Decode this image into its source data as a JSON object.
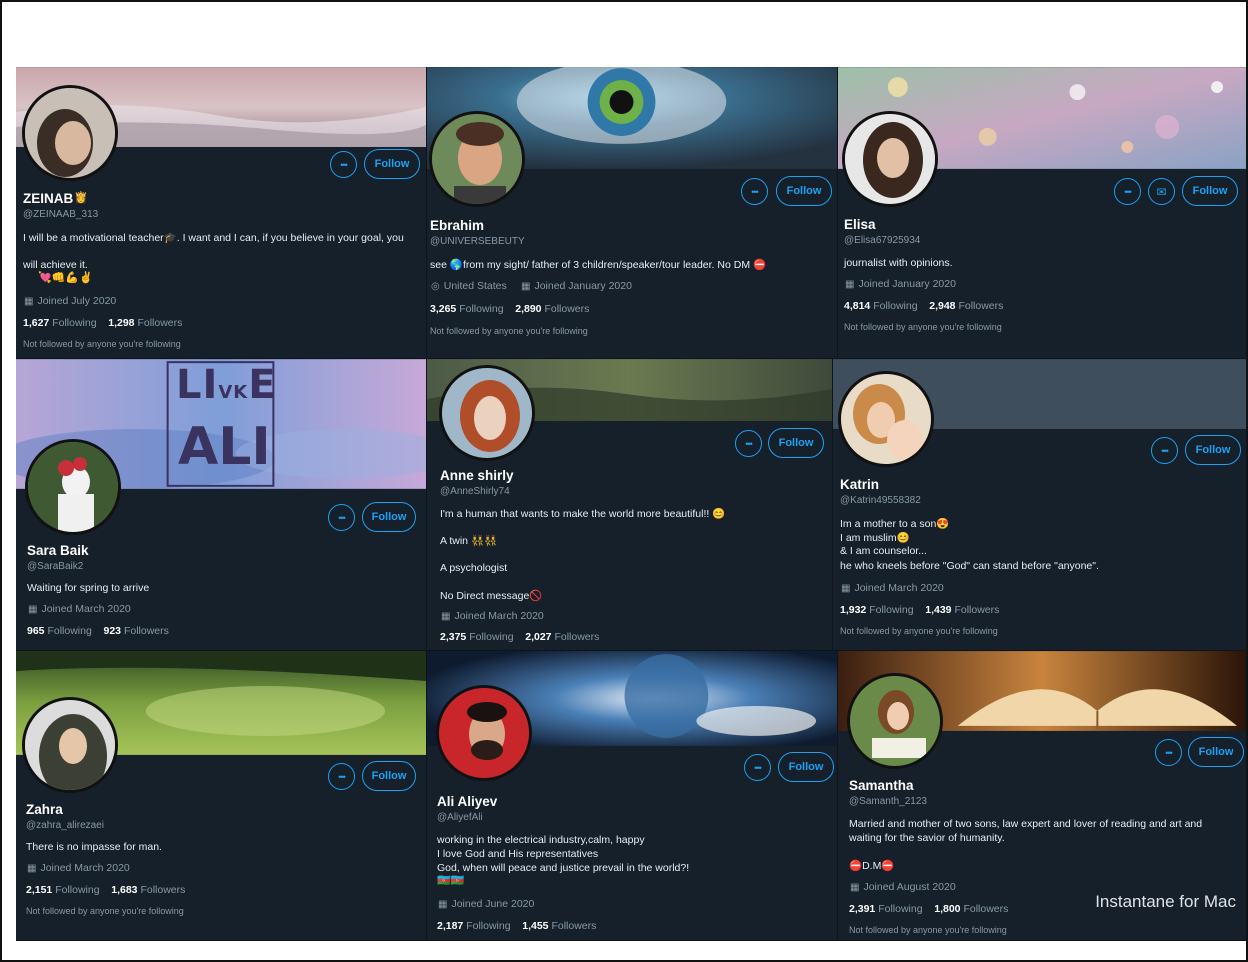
{
  "buttons": {
    "follow": "Follow",
    "more": "•••"
  },
  "watermark": "Instantane for Mac",
  "cards": [
    {
      "name": "ZEINAB",
      "handle": "@ZEINAAB_313",
      "bio1": "I will be a motivational teacher",
      "bio1b": ". I want and I can, if you believe in your goal, you",
      "bio2": "will achieve it.",
      "joined": "Joined July 2020",
      "following": "1,627",
      "followers": "1,298",
      "note": "Not followed by anyone you're following"
    },
    {
      "name": "Ebrahim",
      "handle": "@UNIVERSEBEUTY",
      "bio1": "see",
      "bio1b": "from my sight/ father of 3 children/speaker/tour leader.  No DM",
      "location": "United States",
      "joined": "Joined January 2020",
      "following": "3,265",
      "followers": "2,890",
      "note": "Not followed by anyone you're following"
    },
    {
      "name": "Elisa",
      "handle": "@Elisa67925934",
      "bio1": "journalist with opinions.",
      "joined": "Joined January 2020",
      "following": "4,814",
      "followers": "2,948",
      "note": "Not followed by anyone you're following"
    },
    {
      "name": "Sara Baik",
      "handle": "@SaraBaik2",
      "bio1": "Waiting for spring to arrive",
      "joined": "Joined March 2020",
      "following": "965",
      "followers": "923",
      "banner_text1": "LI",
      "banner_text2": "VK",
      "banner_text3": "E",
      "banner_text4": "ALI"
    },
    {
      "name": "Anne shirly",
      "handle": "@AnneShirly74",
      "bio1": "I'm a human that wants to make the world more beautiful!!",
      "bio2": "A twin",
      "bio3": "A psychologist",
      "bio4": "No Direct message",
      "joined": "Joined March 2020",
      "following": "2,375",
      "followers": "2,027"
    },
    {
      "name": "Katrin",
      "handle": "@Katrin49558382",
      "bio1": "Im a mother to a son",
      "bio2": "I am muslim",
      "bio3": "& I am counselor...",
      "bio4": "he who kneels before \"God\" can stand before \"anyone\".",
      "joined": "Joined March 2020",
      "following": "1,932",
      "followers": "1,439",
      "note": "Not followed by anyone you're following"
    },
    {
      "name": "Zahra",
      "handle": "@zahra_alirezaei",
      "bio1": "There is no impasse for man.",
      "joined": "Joined March 2020",
      "following": "2,151",
      "followers": "1,683",
      "note": "Not followed by anyone you're following"
    },
    {
      "name": "Ali Aliyev",
      "handle": "@AliyefAli",
      "bio1": "working in the electrical industry,calm, happy",
      "bio2": "I love God and His representatives",
      "bio3": "God, when will peace and justice prevail in the world?!",
      "joined": "Joined June 2020",
      "following": "2,187",
      "followers": "1,455"
    },
    {
      "name": "Samantha",
      "handle": "@Samanth_2123",
      "bio1": "Married and mother of two sons, law expert and lover of reading and art and",
      "bio2": "waiting for the savior of humanity.",
      "bio3": "D.M",
      "joined": "Joined August 2020",
      "following": "2,391",
      "followers": "1,800",
      "note": "Not followed by anyone you're following"
    }
  ],
  "labels": {
    "following": "Following",
    "followers": "Followers"
  }
}
